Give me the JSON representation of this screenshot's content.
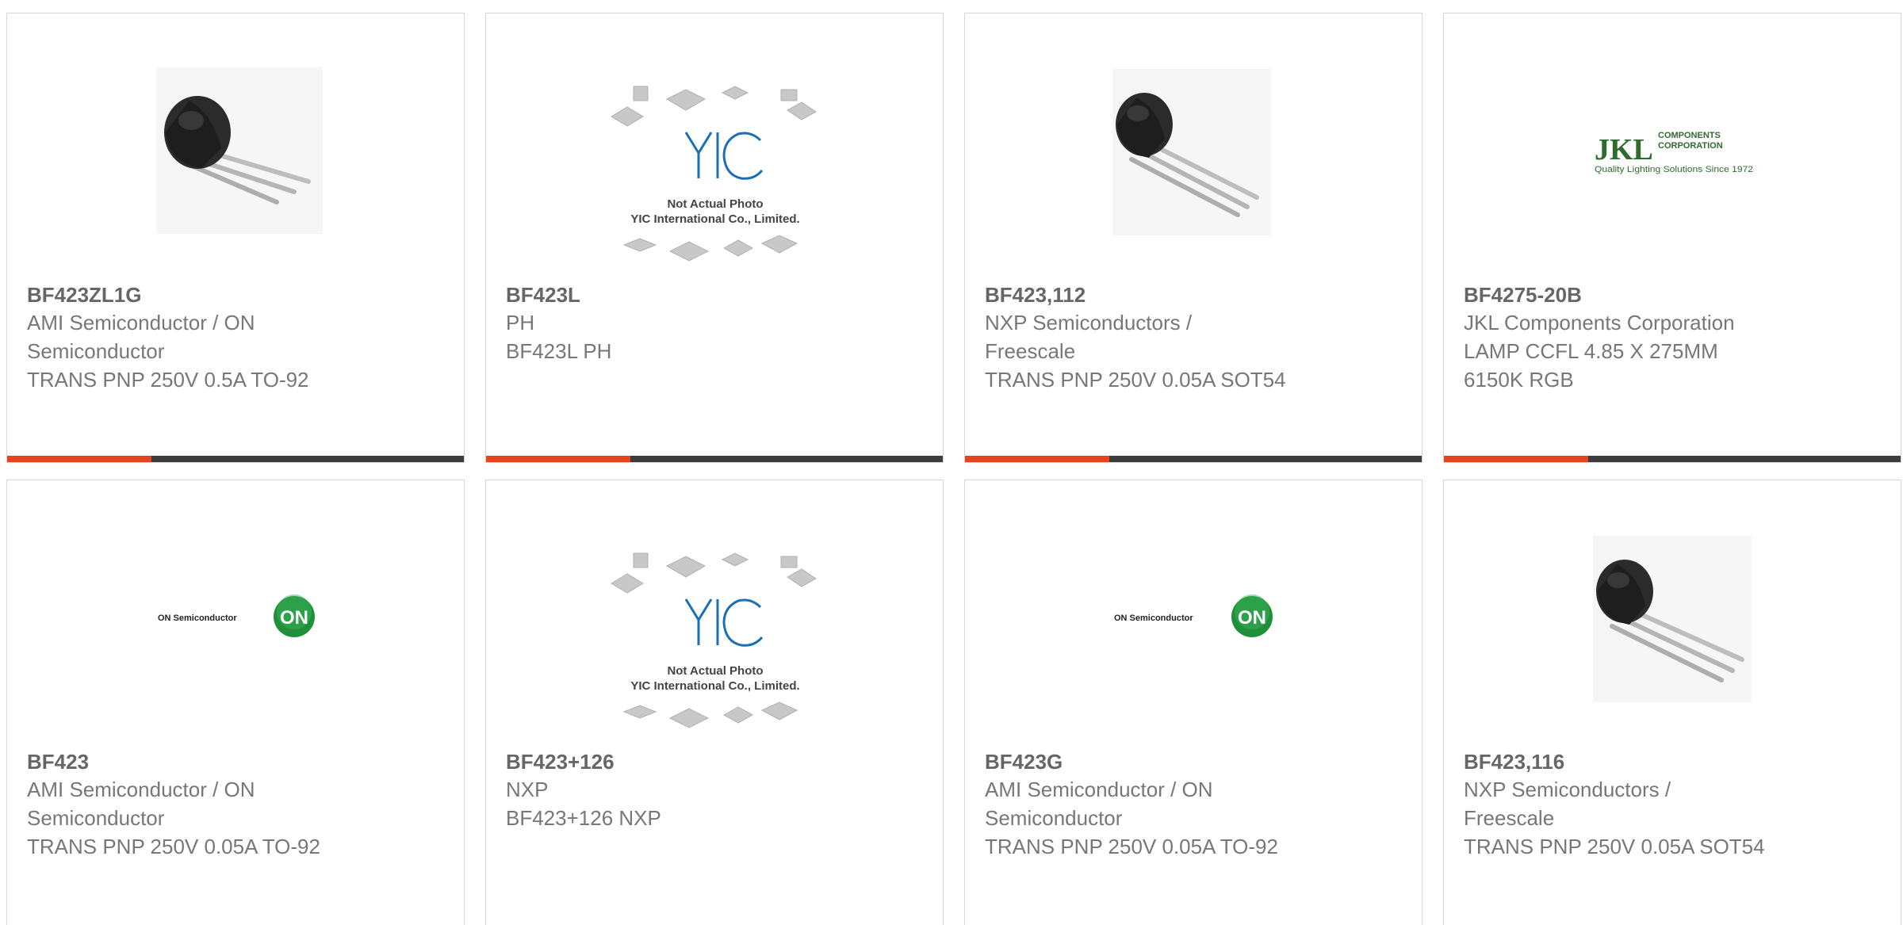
{
  "colors": {
    "accent": "#e8431a",
    "bar": "#3d3d3d",
    "title": "#666666",
    "text": "#777777",
    "border": "#d6d6d6",
    "on_green": "#1f8f3a",
    "yic_blue": "#1a6fb5",
    "jkl_green": "#2f6b2f"
  },
  "products": [
    {
      "part": "BF423ZL1G",
      "manufacturer": "AMI Semiconductor / ON Semiconductor",
      "description": "TRANS PNP 250V 0.5A TO-92",
      "image": "to92-transistor-photo"
    },
    {
      "part": "BF423L",
      "manufacturer": "PH",
      "description": "BF423L PH",
      "image": "yic-placeholder",
      "image_text_1": "Not Actual Photo",
      "image_text_2": "YIC International Co., Limited.",
      "image_logo": "YIC"
    },
    {
      "part": "BF423,112",
      "manufacturer": "NXP Semiconductors / Freescale",
      "description": "TRANS PNP 250V 0.05A SOT54",
      "image": "to92-transistor-photo"
    },
    {
      "part": "BF4275-20B",
      "manufacturer": "JKL Components Corporation",
      "description": "LAMP CCFL 4.85 X 275MM 6150K RGB",
      "image": "jkl-logo",
      "image_logo": "JKL",
      "image_text_1": "COMPONENTS",
      "image_text_2": "CORPORATION",
      "image_text_3": "Quality Lighting Solutions Since 1972"
    },
    {
      "part": "BF423",
      "manufacturer": "AMI Semiconductor / ON Semiconductor",
      "description": "TRANS PNP 250V 0.05A TO-92",
      "image": "on-semi-logo",
      "image_text_1": "ON Semiconductor",
      "image_logo": "ON"
    },
    {
      "part": "BF423+126",
      "manufacturer": "NXP",
      "description": "BF423+126 NXP",
      "image": "yic-placeholder",
      "image_text_1": "Not Actual Photo",
      "image_text_2": "YIC International Co., Limited.",
      "image_logo": "YIC"
    },
    {
      "part": "BF423G",
      "manufacturer": "AMI Semiconductor / ON Semiconductor",
      "description": "TRANS PNP 250V 0.05A TO-92",
      "image": "on-semi-logo",
      "image_text_1": "ON Semiconductor",
      "image_logo": "ON"
    },
    {
      "part": "BF423,116",
      "manufacturer": "NXP Semiconductors / Freescale",
      "description": "TRANS PNP 250V 0.05A SOT54",
      "image": "to92-transistor-photo"
    }
  ]
}
